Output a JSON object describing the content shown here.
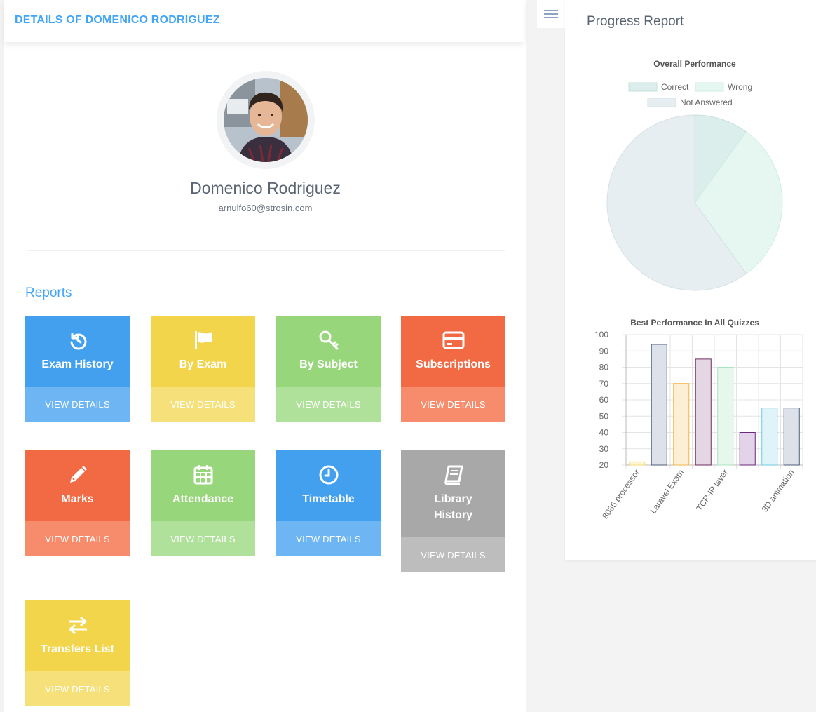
{
  "header": {
    "title": "DETAILS OF DOMENICO RODRIGUEZ"
  },
  "profile": {
    "name": "Domenico Rodriguez",
    "email": "arnulfo60@strosin.com",
    "avatar_icon": "user-photo"
  },
  "reports": {
    "heading": "Reports",
    "tiles": [
      {
        "label": "Exam History",
        "action": "VIEW DETAILS",
        "icon": "history-icon",
        "color": "#42a0ef",
        "light": "#6db6f3"
      },
      {
        "label": "By Exam",
        "action": "VIEW DETAILS",
        "icon": "flag-icon",
        "color": "#f2d54a",
        "light": "#f5e07a"
      },
      {
        "label": "By Subject",
        "action": "VIEW DETAILS",
        "icon": "key-icon",
        "color": "#97d67b",
        "light": "#b0e19a"
      },
      {
        "label": "Subscriptions",
        "action": "VIEW DETAILS",
        "icon": "credit-card-icon",
        "color": "#f26a43",
        "light": "#f68c6c"
      },
      {
        "label": "Marks",
        "action": "VIEW DETAILS",
        "icon": "pencil-icon",
        "color": "#f26a43",
        "light": "#f68c6c"
      },
      {
        "label": "Attendance",
        "action": "VIEW DETAILS",
        "icon": "calendar-icon",
        "color": "#97d67b",
        "light": "#b0e19a"
      },
      {
        "label": "Timetable",
        "action": "VIEW DETAILS",
        "icon": "clock-icon",
        "color": "#42a0ef",
        "light": "#6db6f3"
      },
      {
        "label": "Library History",
        "action": "VIEW DETAILS",
        "icon": "book-icon",
        "color": "#a8a8a8",
        "light": "#bdbdbd"
      },
      {
        "label": "Transfers List",
        "action": "VIEW DETAILS",
        "icon": "transfer-icon",
        "color": "#f2d54a",
        "light": "#f5e07a"
      }
    ]
  },
  "sidebar": {
    "menu_icon": "hamburger-icon"
  },
  "progress": {
    "title": "Progress Report"
  },
  "chart_data": [
    {
      "type": "pie",
      "title": "Overall Performance",
      "legend_position": "top",
      "labels": [
        "Correct",
        "Wrong",
        "Not Answered"
      ],
      "values": [
        10,
        30,
        60
      ],
      "colors": [
        "#dbeeeb",
        "#e6f7f1",
        "#e7eef1"
      ],
      "border_colors": [
        "#c6e0dc",
        "#cdeee0",
        "#d5e0e4"
      ]
    },
    {
      "type": "bar",
      "title": "Best Performance In All Quizzes",
      "categories": [
        "8085 processor",
        "",
        "Laravel Exam",
        "",
        "TCP-IP layer",
        "",
        "",
        "3D animation"
      ],
      "values": [
        22,
        94,
        70,
        85,
        80,
        40,
        55,
        55
      ],
      "fills": [
        "#fdf6d5",
        "#dde2ea",
        "#fdefd6",
        "#e5d6e3",
        "#e6f7ec",
        "#e3d3ea",
        "#dff3f8",
        "#dde2ea"
      ],
      "strokes": [
        "#f3dc7a",
        "#4b5f7a",
        "#f2b545",
        "#6d2f5e",
        "#a8e4bd",
        "#6a2a7a",
        "#6ccde3",
        "#4b5f7a"
      ],
      "ylim": [
        20,
        100
      ],
      "yticks": [
        "100",
        "90",
        "80",
        "70",
        "60",
        "50",
        "40",
        "30",
        "20"
      ],
      "grid": true
    }
  ]
}
